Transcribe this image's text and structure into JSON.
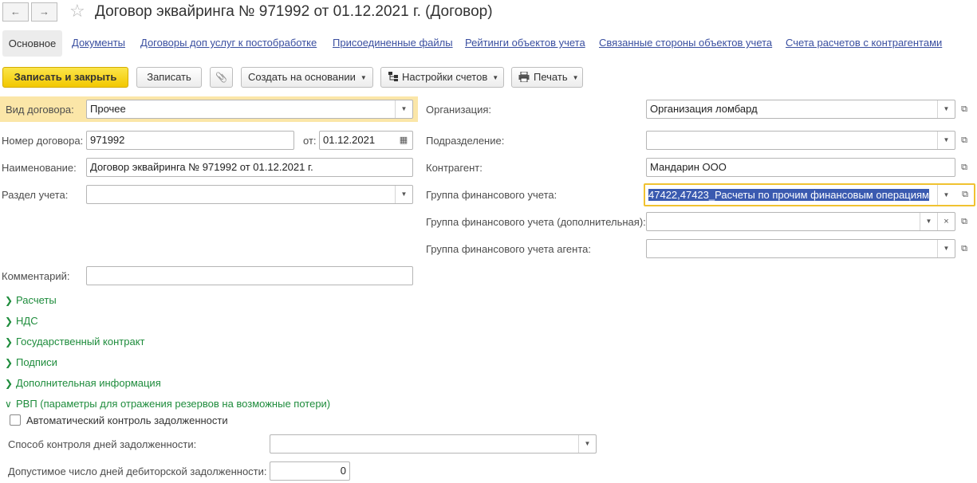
{
  "window": {
    "title": "Договор эквайринга № 971992 от 01.12.2021 г. (Договор)",
    "back_icon": "←",
    "forward_icon": "→",
    "favorite_icon": "☆"
  },
  "tabs": {
    "main": "Основное",
    "documents": "Документы",
    "extra_contracts": "Договоры доп услуг к постобработке",
    "files": "Присоединенные файлы",
    "ratings": "Рейтинги объектов учета",
    "related_parties": "Связанные стороны объектов учета",
    "accounts": "Счета расчетов с контрагентами"
  },
  "toolbar": {
    "save_close": "Записать и закрыть",
    "save": "Записать",
    "attach_icon": "📎",
    "create_based": "Создать на основании",
    "account_settings": "Настройки счетов",
    "print": "Печать"
  },
  "form": {
    "contract_type": {
      "label": "Вид договора:",
      "value": "Прочее"
    },
    "contract_number": {
      "label": "Номер договора:",
      "value": "971992"
    },
    "date": {
      "label": "от:",
      "value": "01.12.2021"
    },
    "name": {
      "label": "Наименование:",
      "value": "Договор эквайринга № 971992 от 01.12.2021 г."
    },
    "section": {
      "label": "Раздел учета:",
      "value": ""
    },
    "comment": {
      "label": "Комментарий:",
      "value": ""
    },
    "organization": {
      "label": "Организация:",
      "value": "Организация ломбард"
    },
    "subdivision": {
      "label": "Подразделение:",
      "value": ""
    },
    "counterparty": {
      "label": "Контрагент:",
      "value": "Мандарин ООО"
    },
    "fin_group": {
      "label": "Группа финансового учета:",
      "value": "47422,47423_Расчеты по прочим финансовым операциям"
    },
    "fin_group_extra": {
      "label": "Группа финансового учета (дополнительная):",
      "value": ""
    },
    "fin_group_agent": {
      "label": "Группа финансового учета агента:",
      "value": ""
    }
  },
  "groups": {
    "payments": "Расчеты",
    "vat": "НДС",
    "gov_contract": "Государственный контракт",
    "signatures": "Подписи",
    "additional_info": "Дополнительная информация",
    "rvp": "РВП (параметры для отражения резервов на возможные потери)"
  },
  "rvp": {
    "auto_control": "Автоматический контроль задолженности",
    "auto_control_checked": false,
    "control_method": {
      "label": "Способ контроля дней задолженности:",
      "value": ""
    },
    "allowed_days": {
      "label": "Допустимое число дней дебиторской задолженности:",
      "value": "0"
    }
  },
  "colors": {
    "accent_primary": "#f2c800",
    "highlight_row": "#fbe6a8",
    "link": "#3a4fa0",
    "group": "#1e8c3c",
    "selection": "#3a5ab0"
  }
}
